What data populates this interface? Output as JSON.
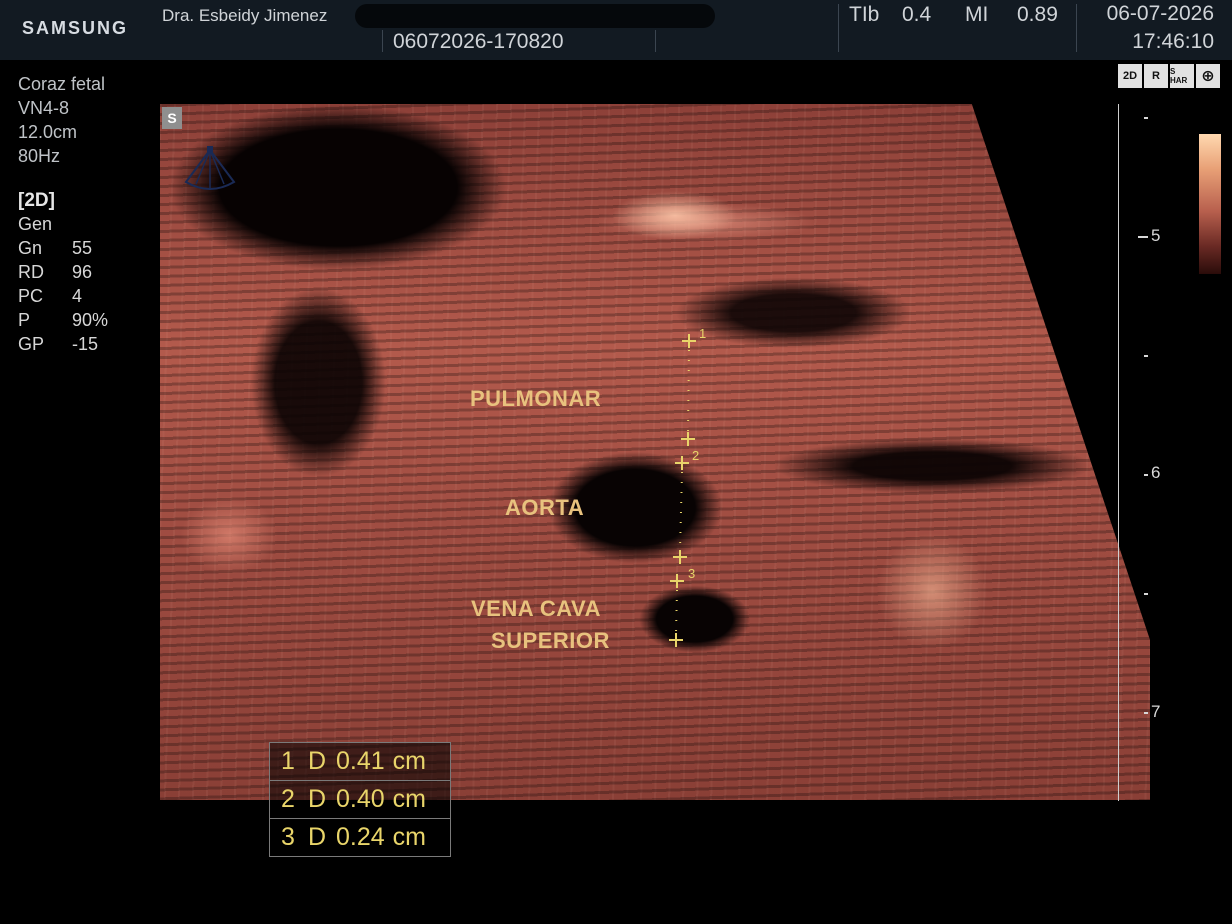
{
  "header": {
    "brand": "SAMSUNG",
    "doctor": "Dra. Esbeidy Jimenez",
    "study_id": "06072026-170820",
    "tib_label": "TIb",
    "tib_value": "0.4",
    "mi_label": "MI",
    "mi_value": "0.89",
    "date": "06-07-2026",
    "time": "17:46:10"
  },
  "params": {
    "preset": "Coraz fetal",
    "probe": "VN4-8",
    "depth": "12.0cm",
    "frame_rate": "80Hz",
    "mode": "[2D]",
    "mode_sub": "Gen",
    "rows": [
      {
        "label": "Gn",
        "value": "55"
      },
      {
        "label": "RD",
        "value": "96"
      },
      {
        "label": "PC",
        "value": "4"
      },
      {
        "label": "P",
        "value": "90%"
      },
      {
        "label": "GP",
        "value": "-15"
      }
    ]
  },
  "image": {
    "s_badge": "S",
    "labels": {
      "pulmonar": "PULMONAR",
      "aorta": "AORTA",
      "vena_cava_1": "VENA CAVA",
      "vena_cava_2": "SUPERIOR"
    },
    "caliper_nums": [
      "1",
      "2",
      "3"
    ]
  },
  "depth_scale": {
    "labels": [
      "5",
      "6",
      "7"
    ]
  },
  "mode_icons": [
    "2D",
    "R",
    "S HAR",
    "⊕"
  ],
  "measurements": [
    {
      "index": "1",
      "type": "D",
      "value": "0.41",
      "unit": "cm"
    },
    {
      "index": "2",
      "type": "D",
      "value": "0.40",
      "unit": "cm"
    },
    {
      "index": "3",
      "type": "D",
      "value": "0.24",
      "unit": "cm"
    }
  ],
  "colors": {
    "header_bg": "#121a22",
    "tissue": "#b35a4c",
    "label_color": "#e8c27e",
    "caliper": "#e9d56a"
  }
}
